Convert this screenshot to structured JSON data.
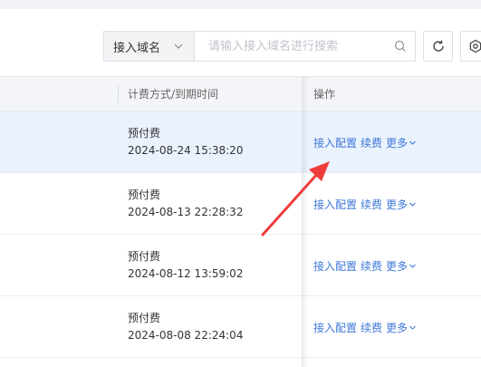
{
  "toolbar": {
    "search_field_select": "接入域名",
    "search_placeholder": "请输入接入域名进行搜索"
  },
  "table": {
    "columns": {
      "billing": "计费方式/到期时间",
      "operations": "操作"
    },
    "action_labels": {
      "access_config": "接入配置",
      "renew": "续费",
      "more": "更多"
    },
    "rows": [
      {
        "billing_type": "预付费",
        "expiry": "2024-08-24 15:38:20",
        "highlighted": true
      },
      {
        "billing_type": "预付费",
        "expiry": "2024-08-13 22:28:32",
        "highlighted": false
      },
      {
        "billing_type": "预付费",
        "expiry": "2024-08-12 13:59:02",
        "highlighted": false
      },
      {
        "billing_type": "预付费",
        "expiry": "2024-08-08 22:24:04",
        "highlighted": false
      }
    ]
  },
  "annotation": {
    "arrow_color": "#f03c3c"
  },
  "colors": {
    "link": "#3f78d8",
    "highlight_row": "#eaf2fd",
    "header_bg": "#f3f5f8"
  }
}
